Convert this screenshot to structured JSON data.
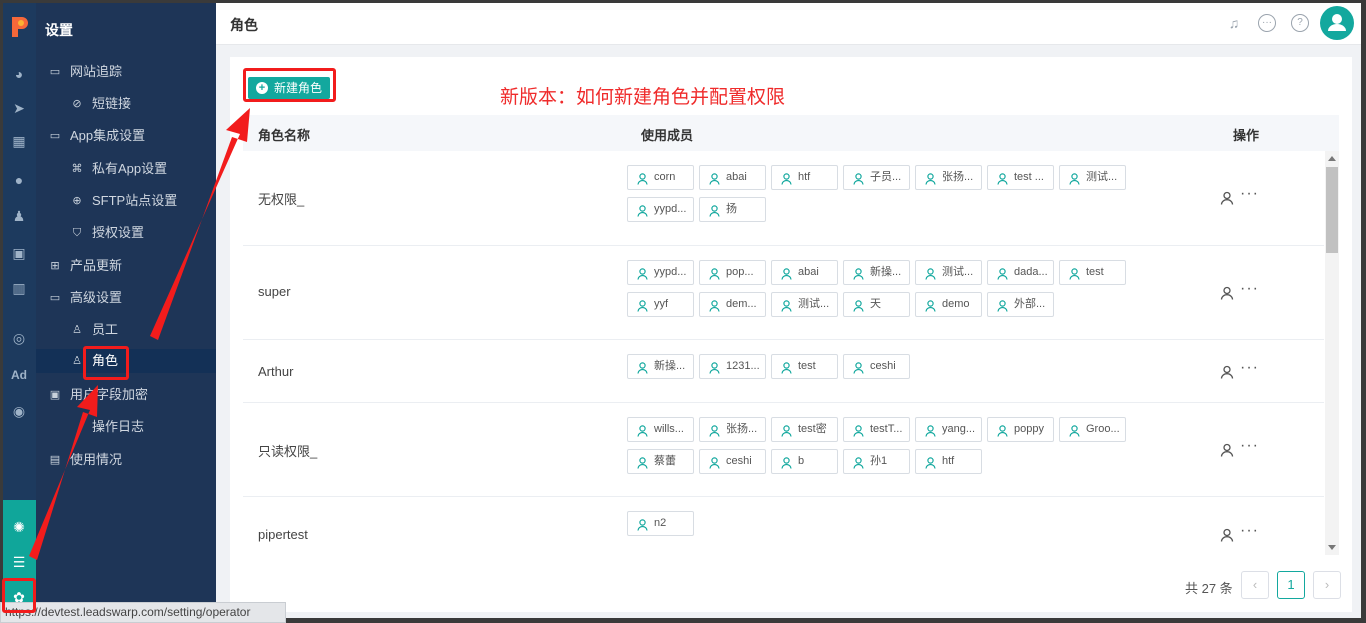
{
  "sidebar": {
    "title": "设置",
    "items": [
      {
        "label": "网站追踪",
        "icon": "folder-icon",
        "level": 1
      },
      {
        "label": "短链接",
        "icon": "link-icon",
        "level": 2
      },
      {
        "label": "App集成设置",
        "icon": "folder-icon",
        "level": 1
      },
      {
        "label": "私有App设置",
        "icon": "apps-icon",
        "level": 2
      },
      {
        "label": "SFTP站点设置",
        "icon": "globe-icon",
        "level": 2
      },
      {
        "label": "授权设置",
        "icon": "shield-icon",
        "level": 2
      },
      {
        "label": "产品更新",
        "icon": "grid-icon",
        "level": 1
      },
      {
        "label": "高级设置",
        "icon": "folder-icon",
        "level": 1
      },
      {
        "label": "员工",
        "icon": "user-icon",
        "level": 2
      },
      {
        "label": "角色",
        "icon": "users-icon",
        "level": 2,
        "active": true
      },
      {
        "label": "用户字段加密",
        "icon": "lock-field-icon",
        "level": 1
      },
      {
        "label": "操作日志",
        "icon": "log-icon",
        "level": 2
      },
      {
        "label": "使用情况",
        "icon": "usage-icon",
        "level": 1
      }
    ]
  },
  "rail": {
    "icons": [
      "logo",
      "dashboard-icon",
      "send-icon",
      "layout-icon",
      "person-icon",
      "group-icon",
      "bookmark-icon",
      "bar-chart-icon",
      "wechat-icon",
      "ad-icon",
      "target-icon",
      "analytics-icon",
      "server-icon",
      "settings-icon"
    ],
    "ad_label": "Ad"
  },
  "header": {
    "title": "角色"
  },
  "toolbar": {
    "new_role_label": "新建角色",
    "annotation": "新版本：如何新建角色并配置权限"
  },
  "table": {
    "columns": [
      "角色名称",
      "使用成员",
      "操作"
    ],
    "rows": [
      {
        "name": "无权限_",
        "members": [
          "corn",
          "abai",
          "htf",
          "子员...",
          "张扬...",
          "test ...",
          "测试...",
          "yypd...",
          "扬"
        ]
      },
      {
        "name": "super",
        "members": [
          "yypd...",
          "pop...",
          "abai",
          "新操...",
          "测试...",
          "dada...",
          "test",
          "yyf",
          "dem...",
          "测试...",
          "天",
          "demo",
          "外部..."
        ]
      },
      {
        "name": "Arthur",
        "members": [
          "新操...",
          "1231...",
          "test",
          "ceshi"
        ]
      },
      {
        "name": "只读权限_",
        "members": [
          "wills...",
          "张扬...",
          "test密",
          "testT...",
          "yang...",
          "poppy",
          "Groo...",
          "蔡蕾",
          "ceshi",
          "b",
          "孙1",
          "htf"
        ]
      },
      {
        "name": "pipertest",
        "members": [
          "n2"
        ]
      }
    ]
  },
  "pagination": {
    "total": "共 27 条",
    "current_page": "1",
    "prev": "‹",
    "next": "›"
  },
  "status_url": "https://devtest.leadswarp.com/setting/operator",
  "colors": {
    "accent": "#13a89e",
    "nav_bg": "#1e3557",
    "rail_bg": "#1d3a5e",
    "annotation_red": "#ef2b2b"
  }
}
